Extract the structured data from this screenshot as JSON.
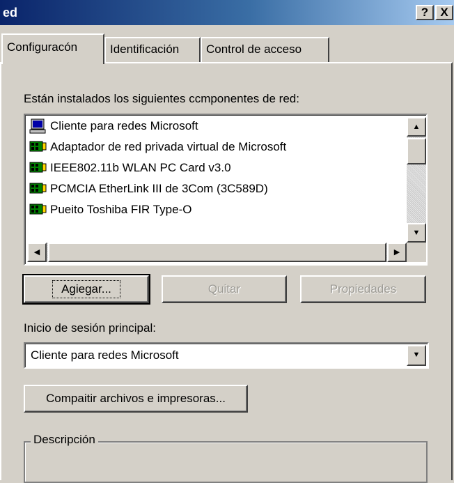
{
  "window": {
    "title": "ed",
    "help_label": "?",
    "close_label": "X"
  },
  "tabs": [
    {
      "label": "Configuracón",
      "active": true
    },
    {
      "label": "Identificación",
      "active": false
    },
    {
      "label": "Control de acceso",
      "active": false
    }
  ],
  "components": {
    "label": "Están instalados los siguientes ccmponentes de red:",
    "items": [
      {
        "label": "Cliente para redes Microsoft",
        "icon": "client-computer-icon"
      },
      {
        "label": "Adaptador de red privada virtual de Microsoft",
        "icon": "network-card-icon"
      },
      {
        "label": "IEEE802.11b WLAN PC Card v3.0",
        "icon": "network-card-icon"
      },
      {
        "label": "PCMCIA EtherLink III de 3Com (3C589D)",
        "icon": "network-card-icon"
      },
      {
        "label": "Pueito Toshiba FIR Type-O",
        "icon": "network-card-icon"
      }
    ]
  },
  "buttons": {
    "add": "Agiegar...",
    "remove": "Quitar",
    "properties": "Propiedades",
    "share": "Compaitir archivos e impresoras..."
  },
  "logon": {
    "label": "Inicio de sesión principal:",
    "selected": "Cliente para redes Microsoft"
  },
  "description": {
    "label": "Descripción"
  },
  "colors": {
    "titlebar_start": "#0a246a",
    "face": "#d4d0c8"
  }
}
